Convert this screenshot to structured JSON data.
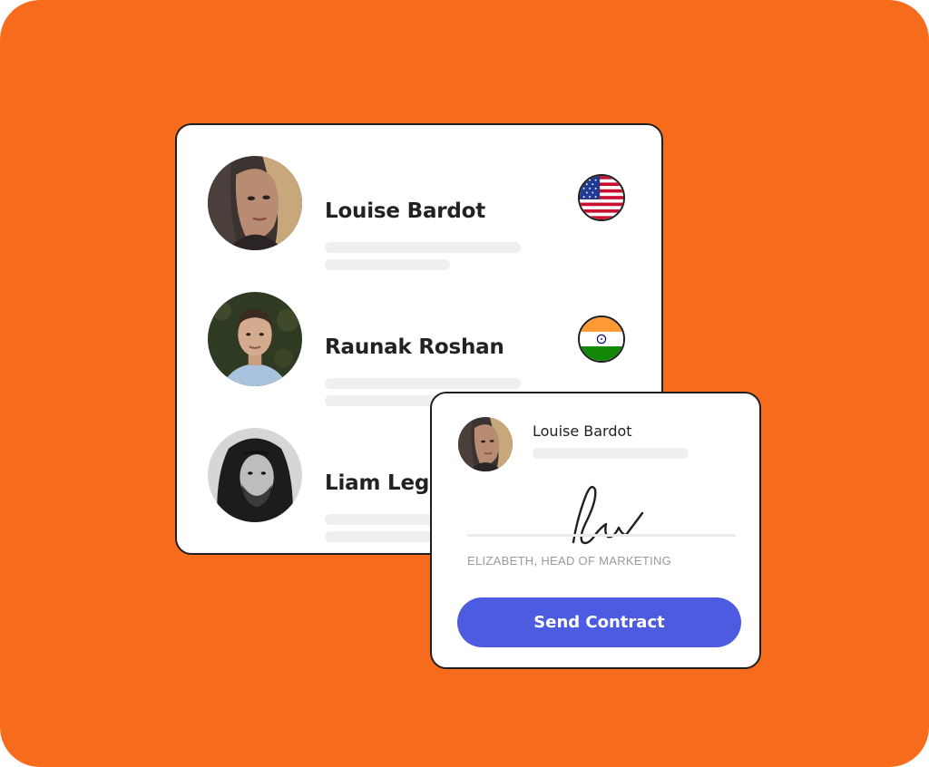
{
  "colors": {
    "background": "#F76B1C",
    "card": "#FFFFFF",
    "card_border": "#1F1F1F",
    "skeleton_line": "#EFEFEF",
    "button": "#4D5BE0",
    "button_text": "#FFFFFF",
    "caption": "#9A9A9A"
  },
  "people": [
    {
      "name": "Louise Bardot",
      "flag": "united-states-flag-icon"
    },
    {
      "name": "Raunak Roshan",
      "flag": "india-flag-icon"
    },
    {
      "name": "Liam Legr",
      "flag": null
    }
  ],
  "contract": {
    "signer_name": "Louise Bardot",
    "signature_caption": "ELIZABETH, HEAD OF MARKETING",
    "send_label": "Send Contract"
  }
}
